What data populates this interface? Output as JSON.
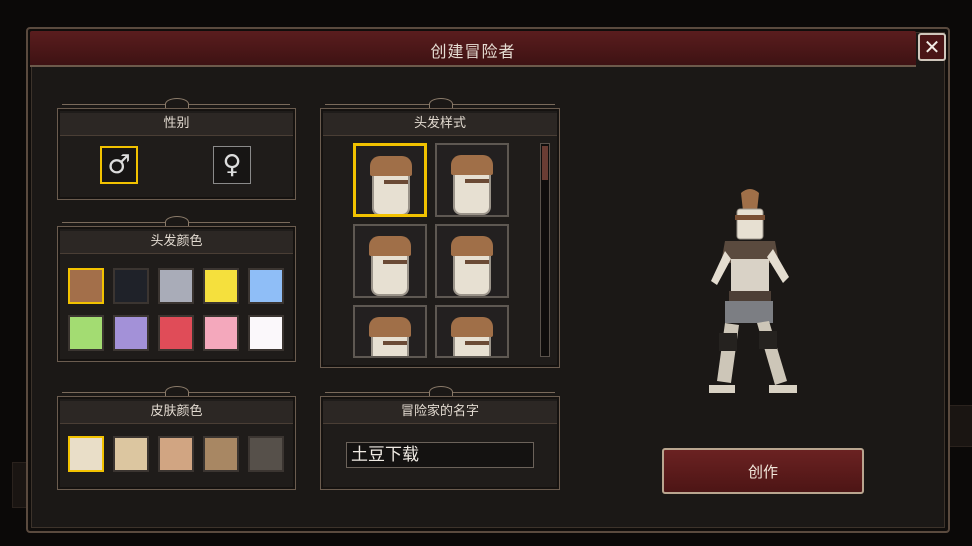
{
  "window": {
    "title": "创建冒险者",
    "close_symbol": "✕"
  },
  "gender": {
    "label": "性别",
    "male_symbol": "♂",
    "female_symbol": "♀",
    "selected": "male"
  },
  "hair_color": {
    "label": "头发颜色",
    "selected_index": 0,
    "colors": [
      "#a36f4a",
      "#1f2229",
      "#a9acb8",
      "#f5e03d",
      "#8fbef7",
      "#a3dc72",
      "#a391d8",
      "#e04c58",
      "#f4a8bc",
      "#fbf8fb"
    ]
  },
  "hair_style": {
    "label": "头发样式",
    "selected_index": 0,
    "count": 6
  },
  "skin_color": {
    "label": "皮肤颜色",
    "selected_index": 0,
    "colors": [
      "#e9dec8",
      "#dcc6a0",
      "#d1a582",
      "#a88763",
      "#56504a"
    ]
  },
  "name": {
    "label": "冒险家的名字",
    "value": "土豆下载"
  },
  "create_button": {
    "label": "创作"
  }
}
